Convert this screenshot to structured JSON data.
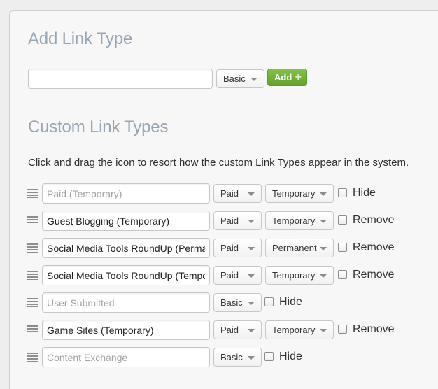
{
  "add_section": {
    "title": "Add Link Type",
    "name_input_value": "",
    "type_select_value": "Basic",
    "add_label": "Add",
    "add_icon": "plus-icon"
  },
  "custom_section": {
    "title": "Custom Link Types",
    "instructions": "Click and drag the icon to resort how the custom Link Types appear in the system.",
    "rows": [
      {
        "name_value": "",
        "name_placeholder": "Paid (Temporary)",
        "type": "Paid",
        "duration": "Temporary",
        "action": "Hide"
      },
      {
        "name_value": "Guest Blogging (Temporary)",
        "name_placeholder": "",
        "type": "Paid",
        "duration": "Temporary",
        "action": "Remove"
      },
      {
        "name_value": "Social Media Tools RoundUp (Permanent)",
        "name_placeholder": "",
        "type": "Paid",
        "duration": "Permanent",
        "action": "Remove"
      },
      {
        "name_value": "Social Media Tools RoundUp (Temporary)",
        "name_placeholder": "",
        "type": "Paid",
        "duration": "Temporary",
        "action": "Remove"
      },
      {
        "name_value": "",
        "name_placeholder": "User Submitted",
        "type": "Basic",
        "duration": "",
        "action": "Hide"
      },
      {
        "name_value": "Game Sites (Temporary)",
        "name_placeholder": "",
        "type": "Paid",
        "duration": "Temporary",
        "action": "Remove"
      },
      {
        "name_value": "",
        "name_placeholder": "Content Exchange",
        "type": "Basic",
        "duration": "",
        "action": "Hide"
      }
    ]
  }
}
